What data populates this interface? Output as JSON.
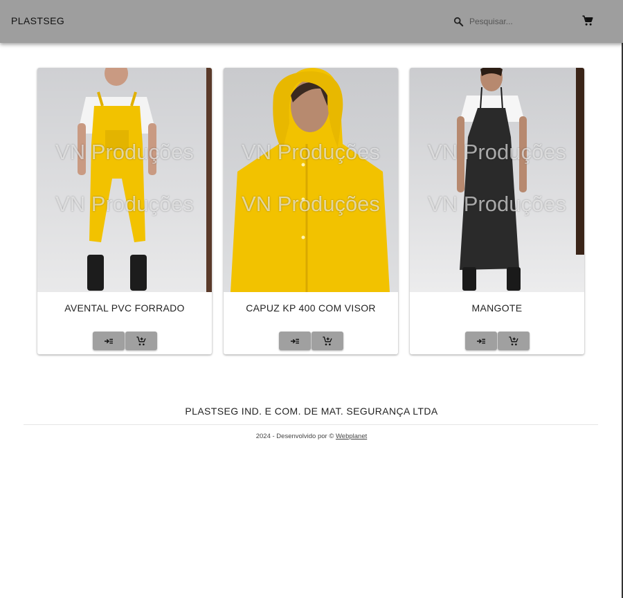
{
  "header": {
    "brand": "PLASTSEG",
    "search_placeholder": "Pesquisar...",
    "search_icon": "search-icon",
    "cart_icon": "cart-icon"
  },
  "watermark": "VN Produções",
  "products": [
    {
      "title": "AVENTAL PVC FORRADO",
      "image": "person in yellow PVC overalls with black boots"
    },
    {
      "title": "CAPUZ KP 400 COM VISOR",
      "image": "woman in yellow hooded raincoat"
    },
    {
      "title": "MANGOTE",
      "image": "woman in black PVC apron with black boots"
    }
  ],
  "product_actions": {
    "details_icon": "arrow-list-icon",
    "add_to_cart_icon": "add-cart-icon"
  },
  "footer": {
    "company": "PLASTSEG IND. E COM. DE MAT. SEGURANÇA LTDA",
    "credits_prefix": "2024 - Desenvolvido por © ",
    "credits_link": "Webplanet"
  },
  "colors": {
    "appbar": "#9e9e9e",
    "button": "#a0a0a0",
    "yellow_product": "#f2c200",
    "black_product": "#2a2a2a"
  }
}
